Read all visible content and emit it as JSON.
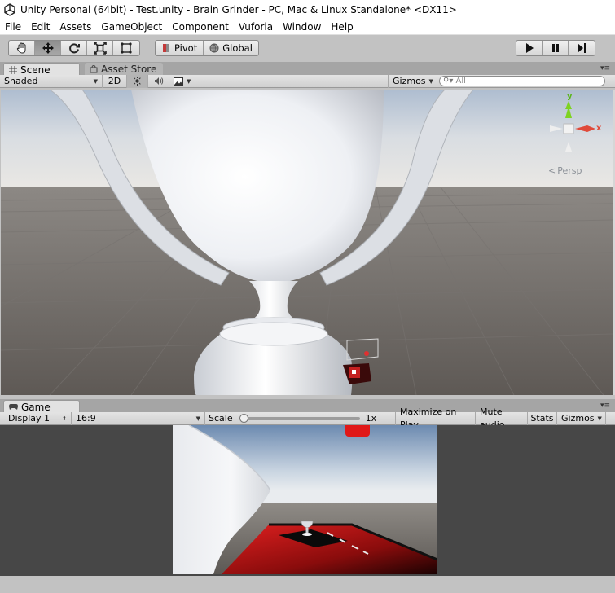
{
  "window": {
    "title": "Unity Personal (64bit) - Test.unity - Brain Grinder - PC, Mac & Linux Standalone* <DX11>"
  },
  "menu": [
    "File",
    "Edit",
    "Assets",
    "GameObject",
    "Component",
    "Vuforia",
    "Window",
    "Help"
  ],
  "toolbar": {
    "tools": [
      "hand-icon",
      "move-icon",
      "rotate-icon",
      "scale-icon",
      "rect-icon"
    ],
    "active_tool": "move-icon",
    "pivot_label": "Pivot",
    "global_label": "Global",
    "play_controls": [
      "play-icon",
      "pause-icon",
      "step-icon"
    ]
  },
  "scene_panel": {
    "tabs": [
      {
        "label": "Scene",
        "icon": "scene-icon",
        "active": true
      },
      {
        "label": "Asset Store",
        "icon": "asset-store-icon",
        "active": false
      }
    ],
    "draw_mode": "Shaded",
    "mode_2d": "2D",
    "gizmos_label": "Gizmos",
    "search_placeholder": "All",
    "persp_label": "Persp",
    "axis_x": "x",
    "axis_y": "y"
  },
  "game_panel": {
    "tab_label": "Game",
    "display": "Display 1",
    "aspect": "16:9",
    "scale_label": "Scale",
    "scale_value": "1x",
    "scale_fraction": 0,
    "buttons": [
      "Maximize on Play",
      "Mute audio",
      "Stats"
    ],
    "gizmos_label": "Gizmos"
  },
  "colors": {
    "editor_bg": "#c2c2c2",
    "tab_bg": "#a5a5a5",
    "sky_top": "#b8c9dd",
    "ground": "#6e6a67",
    "trophy": "#f2f4f7",
    "red_accent": "#e03030",
    "gizmo_green": "#7ed321",
    "gizmo_red": "#e04a3a"
  }
}
